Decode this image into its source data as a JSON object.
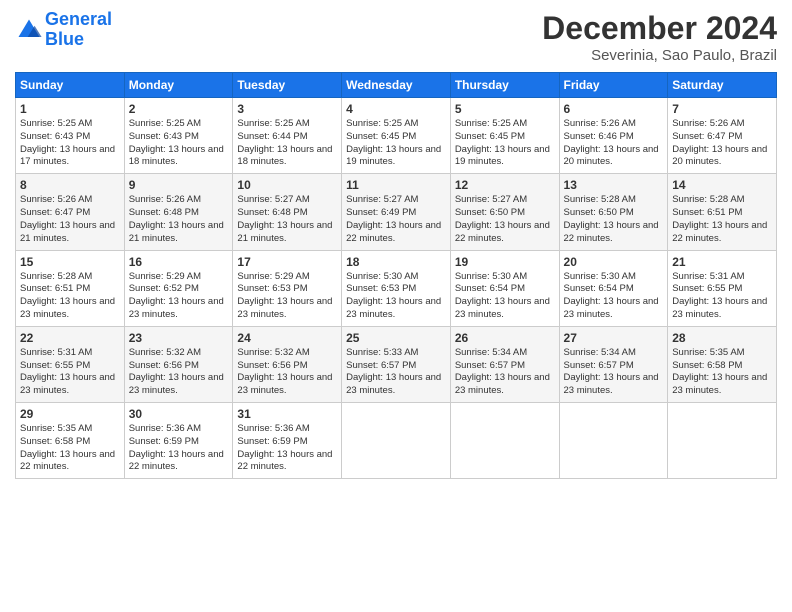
{
  "header": {
    "logo_line1": "General",
    "logo_line2": "Blue",
    "title": "December 2024",
    "subtitle": "Severinia, Sao Paulo, Brazil"
  },
  "weekdays": [
    "Sunday",
    "Monday",
    "Tuesday",
    "Wednesday",
    "Thursday",
    "Friday",
    "Saturday"
  ],
  "weeks": [
    [
      {
        "day": "1",
        "sunrise": "5:25 AM",
        "sunset": "6:43 PM",
        "daylight": "13 hours and 17 minutes."
      },
      {
        "day": "2",
        "sunrise": "5:25 AM",
        "sunset": "6:43 PM",
        "daylight": "13 hours and 18 minutes."
      },
      {
        "day": "3",
        "sunrise": "5:25 AM",
        "sunset": "6:44 PM",
        "daylight": "13 hours and 18 minutes."
      },
      {
        "day": "4",
        "sunrise": "5:25 AM",
        "sunset": "6:45 PM",
        "daylight": "13 hours and 19 minutes."
      },
      {
        "day": "5",
        "sunrise": "5:25 AM",
        "sunset": "6:45 PM",
        "daylight": "13 hours and 19 minutes."
      },
      {
        "day": "6",
        "sunrise": "5:26 AM",
        "sunset": "6:46 PM",
        "daylight": "13 hours and 20 minutes."
      },
      {
        "day": "7",
        "sunrise": "5:26 AM",
        "sunset": "6:47 PM",
        "daylight": "13 hours and 20 minutes."
      }
    ],
    [
      {
        "day": "8",
        "sunrise": "5:26 AM",
        "sunset": "6:47 PM",
        "daylight": "13 hours and 21 minutes."
      },
      {
        "day": "9",
        "sunrise": "5:26 AM",
        "sunset": "6:48 PM",
        "daylight": "13 hours and 21 minutes."
      },
      {
        "day": "10",
        "sunrise": "5:27 AM",
        "sunset": "6:48 PM",
        "daylight": "13 hours and 21 minutes."
      },
      {
        "day": "11",
        "sunrise": "5:27 AM",
        "sunset": "6:49 PM",
        "daylight": "13 hours and 22 minutes."
      },
      {
        "day": "12",
        "sunrise": "5:27 AM",
        "sunset": "6:50 PM",
        "daylight": "13 hours and 22 minutes."
      },
      {
        "day": "13",
        "sunrise": "5:28 AM",
        "sunset": "6:50 PM",
        "daylight": "13 hours and 22 minutes."
      },
      {
        "day": "14",
        "sunrise": "5:28 AM",
        "sunset": "6:51 PM",
        "daylight": "13 hours and 22 minutes."
      }
    ],
    [
      {
        "day": "15",
        "sunrise": "5:28 AM",
        "sunset": "6:51 PM",
        "daylight": "13 hours and 23 minutes."
      },
      {
        "day": "16",
        "sunrise": "5:29 AM",
        "sunset": "6:52 PM",
        "daylight": "13 hours and 23 minutes."
      },
      {
        "day": "17",
        "sunrise": "5:29 AM",
        "sunset": "6:53 PM",
        "daylight": "13 hours and 23 minutes."
      },
      {
        "day": "18",
        "sunrise": "5:30 AM",
        "sunset": "6:53 PM",
        "daylight": "13 hours and 23 minutes."
      },
      {
        "day": "19",
        "sunrise": "5:30 AM",
        "sunset": "6:54 PM",
        "daylight": "13 hours and 23 minutes."
      },
      {
        "day": "20",
        "sunrise": "5:30 AM",
        "sunset": "6:54 PM",
        "daylight": "13 hours and 23 minutes."
      },
      {
        "day": "21",
        "sunrise": "5:31 AM",
        "sunset": "6:55 PM",
        "daylight": "13 hours and 23 minutes."
      }
    ],
    [
      {
        "day": "22",
        "sunrise": "5:31 AM",
        "sunset": "6:55 PM",
        "daylight": "13 hours and 23 minutes."
      },
      {
        "day": "23",
        "sunrise": "5:32 AM",
        "sunset": "6:56 PM",
        "daylight": "13 hours and 23 minutes."
      },
      {
        "day": "24",
        "sunrise": "5:32 AM",
        "sunset": "6:56 PM",
        "daylight": "13 hours and 23 minutes."
      },
      {
        "day": "25",
        "sunrise": "5:33 AM",
        "sunset": "6:57 PM",
        "daylight": "13 hours and 23 minutes."
      },
      {
        "day": "26",
        "sunrise": "5:34 AM",
        "sunset": "6:57 PM",
        "daylight": "13 hours and 23 minutes."
      },
      {
        "day": "27",
        "sunrise": "5:34 AM",
        "sunset": "6:57 PM",
        "daylight": "13 hours and 23 minutes."
      },
      {
        "day": "28",
        "sunrise": "5:35 AM",
        "sunset": "6:58 PM",
        "daylight": "13 hours and 23 minutes."
      }
    ],
    [
      {
        "day": "29",
        "sunrise": "5:35 AM",
        "sunset": "6:58 PM",
        "daylight": "13 hours and 22 minutes."
      },
      {
        "day": "30",
        "sunrise": "5:36 AM",
        "sunset": "6:59 PM",
        "daylight": "13 hours and 22 minutes."
      },
      {
        "day": "31",
        "sunrise": "5:36 AM",
        "sunset": "6:59 PM",
        "daylight": "13 hours and 22 minutes."
      },
      null,
      null,
      null,
      null
    ]
  ]
}
